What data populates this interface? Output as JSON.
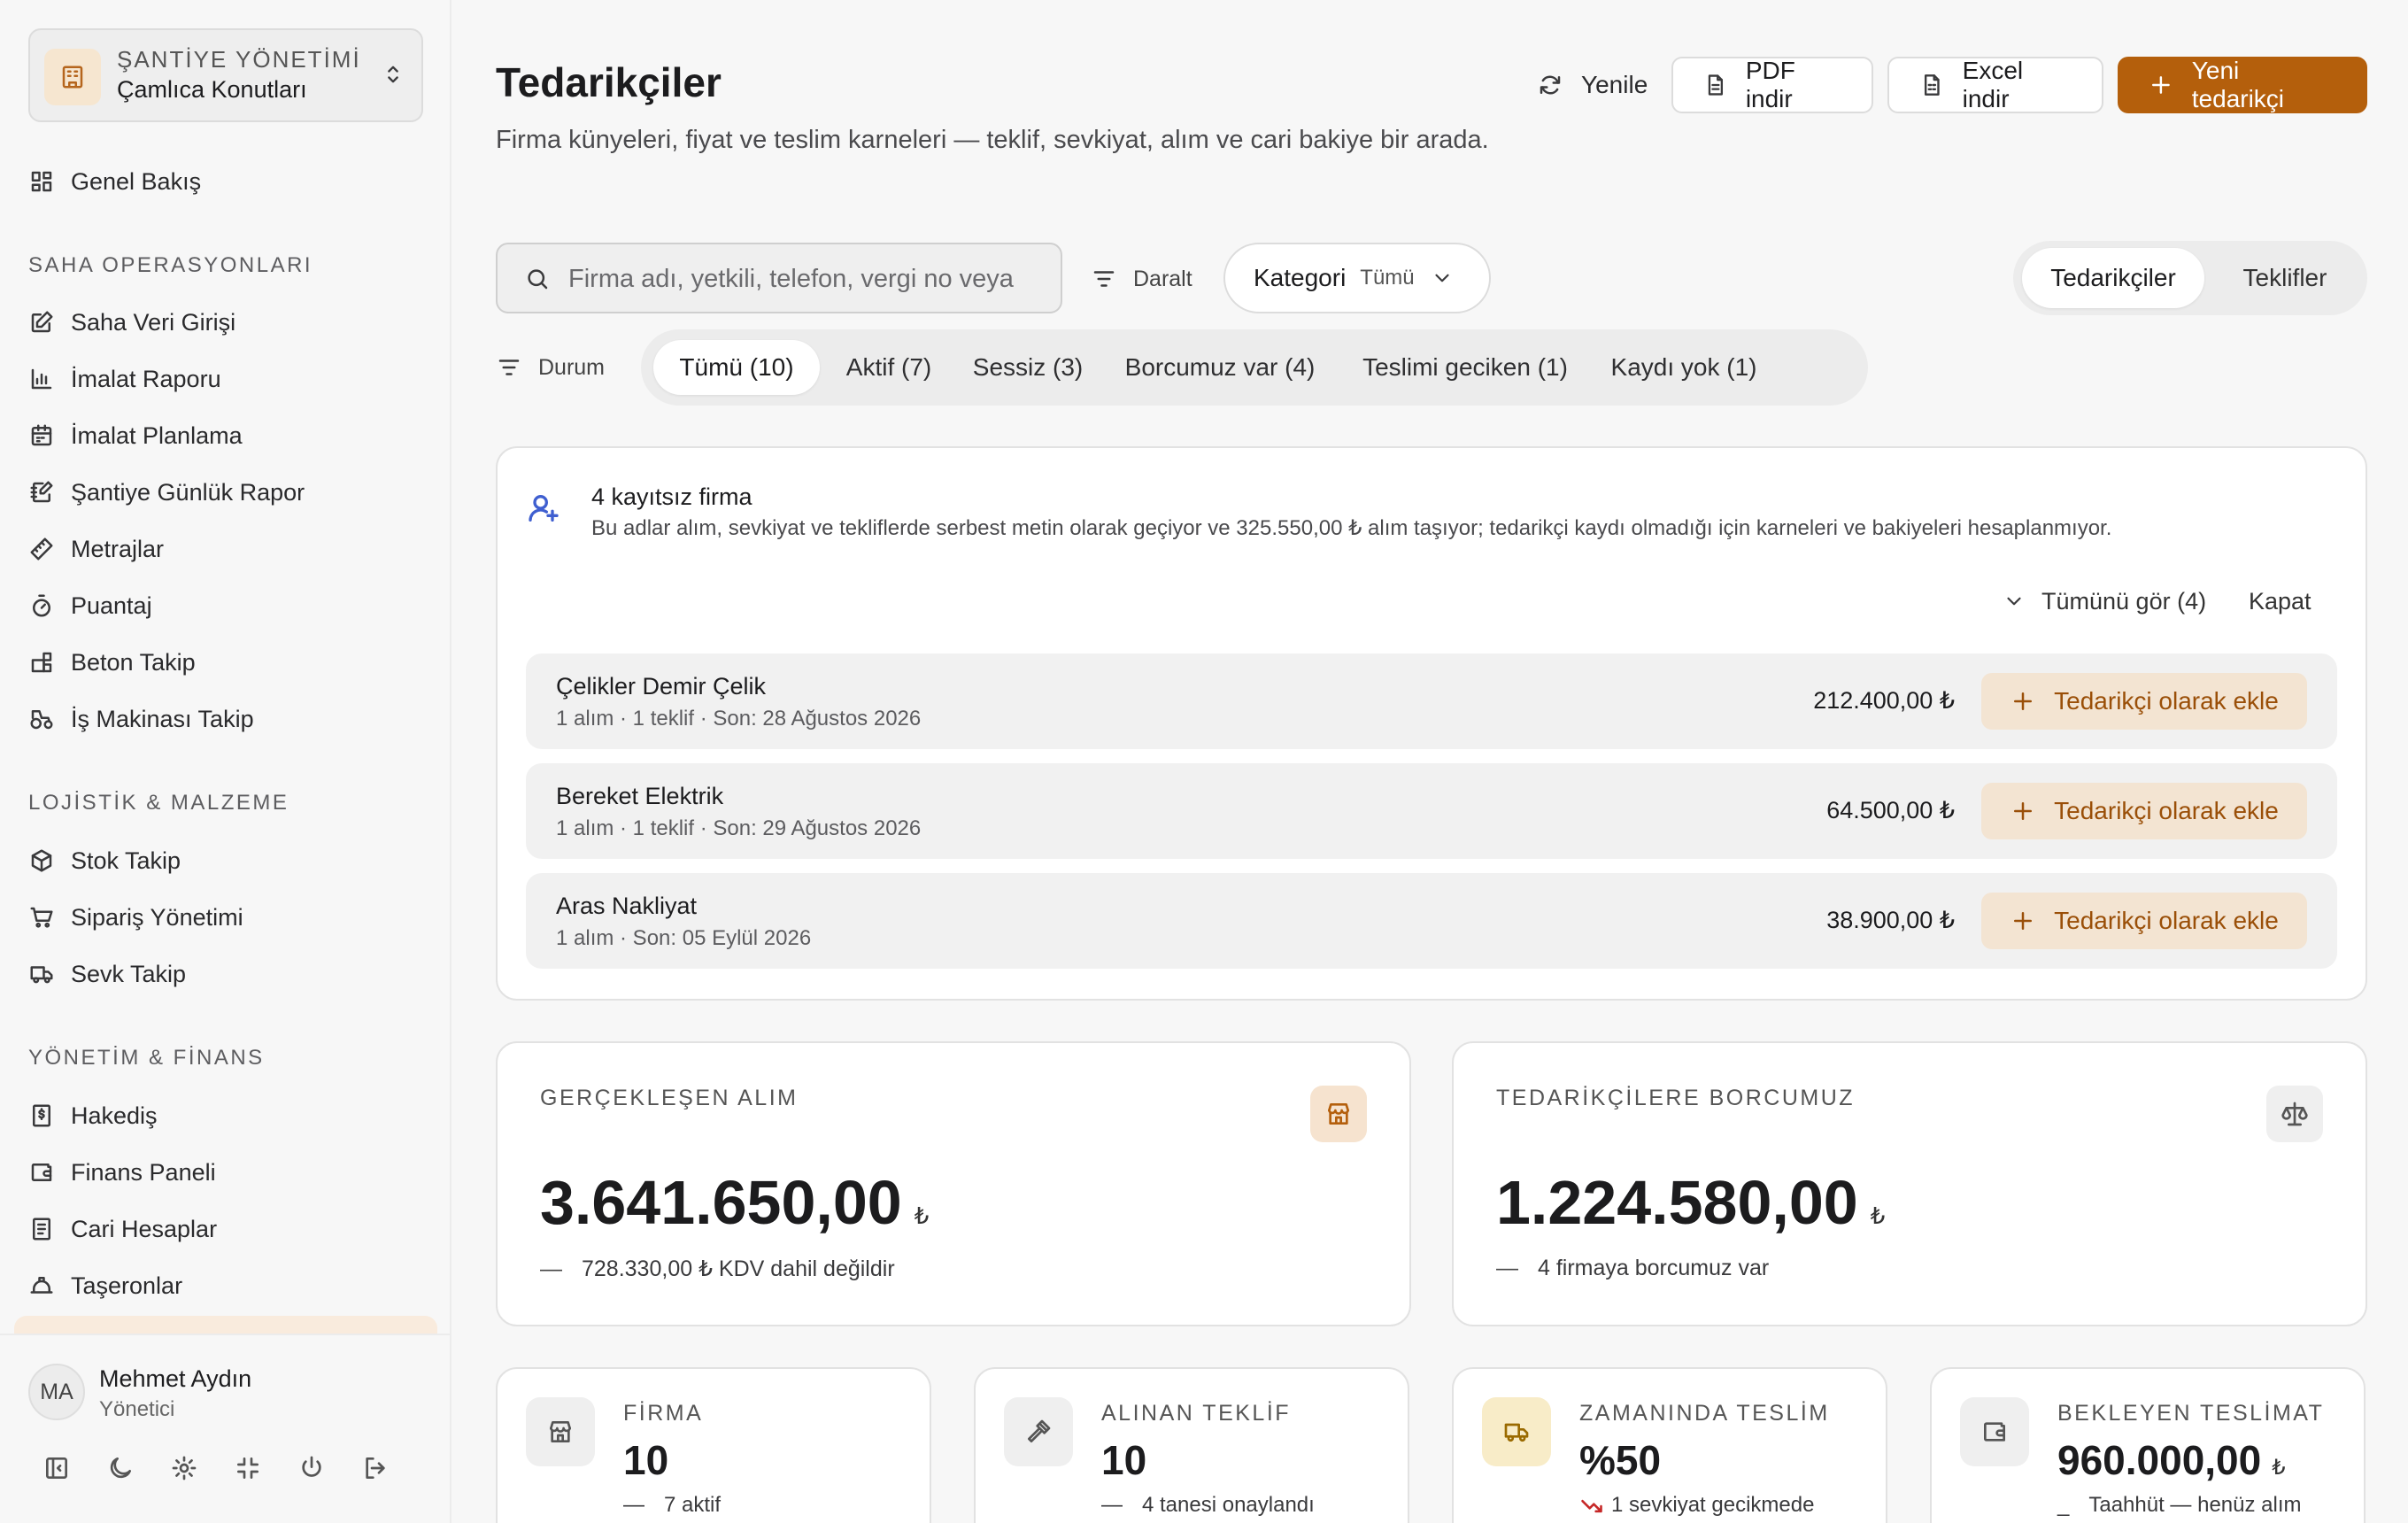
{
  "sidebar": {
    "site_kicker": "ŞANTİYE YÖNETİMİ",
    "site_name": "Çamlıca Konutları",
    "overview": "Genel Bakış",
    "sections": [
      {
        "title": "SAHA OPERASYONLARI",
        "items": [
          "Saha Veri Girişi",
          "İmalat Raporu",
          "İmalat Planlama",
          "Şantiye Günlük Rapor",
          "Metrajlar",
          "Puantaj",
          "Beton Takip",
          "İş Makinası Takip"
        ]
      },
      {
        "title": "LOJİSTİK & MALZEME",
        "items": [
          "Stok Takip",
          "Sipariş Yönetimi",
          "Sevk Takip"
        ]
      },
      {
        "title": "YÖNETİM & FİNANS",
        "items": [
          "Hakediş",
          "Finans Paneli",
          "Cari Hesaplar",
          "Taşeronlar"
        ]
      }
    ],
    "user": {
      "initials": "MA",
      "name": "Mehmet Aydın",
      "role": "Yönetici"
    }
  },
  "header": {
    "title": "Tedarikçiler",
    "subtitle": "Firma künyeleri, fiyat ve teslim karneleri — teklif, sevkiyat, alım ve cari bakiye bir arada.",
    "refresh": "Yenile",
    "pdf": "PDF indir",
    "excel": "Excel indir",
    "new": "Yeni tedarikçi"
  },
  "filters": {
    "search_placeholder": "Firma adı, yetkili, telefon, vergi no veya",
    "narrow": "Daralt",
    "category_label": "Kategori",
    "category_value": "Tümü",
    "view_tabs": [
      "Tedarikçiler",
      "Teklifler"
    ],
    "status_label": "Durum",
    "status_pills": [
      "Tümü (10)",
      "Aktif (7)",
      "Sessiz (3)",
      "Borcumuz var (4)",
      "Teslimi geciken (1)",
      "Kaydı yok (1)"
    ]
  },
  "unregistered": {
    "title": "4 kayıtsız firma",
    "description": "Bu adlar alım, sevkiyat ve tekliflerde serbest metin olarak geçiyor ve 325.550,00 ₺ alım taşıyor; tedarikçi kaydı olmadığı için karneleri ve bakiyeleri hesaplanmıyor.",
    "view_all": "Tümünü gör (4)",
    "close": "Kapat",
    "add_label": "Tedarikçi olarak ekle",
    "rows": [
      {
        "name": "Çelikler Demir Çelik",
        "meta": "1 alım · 1 teklif · Son: 28 Ağustos 2026",
        "amount": "212.400,00 ₺"
      },
      {
        "name": "Bereket Elektrik",
        "meta": "1 alım · 1 teklif · Son: 29 Ağustos 2026",
        "amount": "64.500,00 ₺"
      },
      {
        "name": "Aras Nakliyat",
        "meta": "1 alım · Son: 05 Eylül 2026",
        "amount": "38.900,00 ₺"
      }
    ]
  },
  "kpis": [
    {
      "label": "GERÇEKLEŞEN ALIM",
      "value": "3.641.650,00",
      "currency": "₺",
      "sub": "728.330,00 ₺ KDV dahil değildir",
      "icon": "store-icon"
    },
    {
      "label": "TEDARİKÇİLERE BORCUMUZ",
      "value": "1.224.580,00",
      "currency": "₺",
      "sub": "4 firmaya borcumuz var",
      "icon": "scale-icon"
    }
  ],
  "cards": [
    {
      "label": "FİRMA",
      "value": "10",
      "sub": "7 aktif",
      "icon": "store-icon"
    },
    {
      "label": "ALINAN TEKLİF",
      "value": "10",
      "sub": "4 tanesi onaylandı",
      "icon": "gavel-icon"
    },
    {
      "label": "ZAMANINDA TESLİM",
      "value": "%50",
      "sub": "1 sevkiyat gecikmede",
      "icon": "truck-icon"
    },
    {
      "label": "BEKLEYEN TESLİMAT",
      "value": "960.000,00",
      "currency": "₺",
      "sub": "Taahhüt — henüz alım",
      "icon": "wallet-icon"
    }
  ],
  "colors": {
    "accent": "#b45f0c",
    "accent_soft": "#f3e4d2",
    "warning_soft": "#f8ecc8",
    "danger": "#c62828"
  }
}
